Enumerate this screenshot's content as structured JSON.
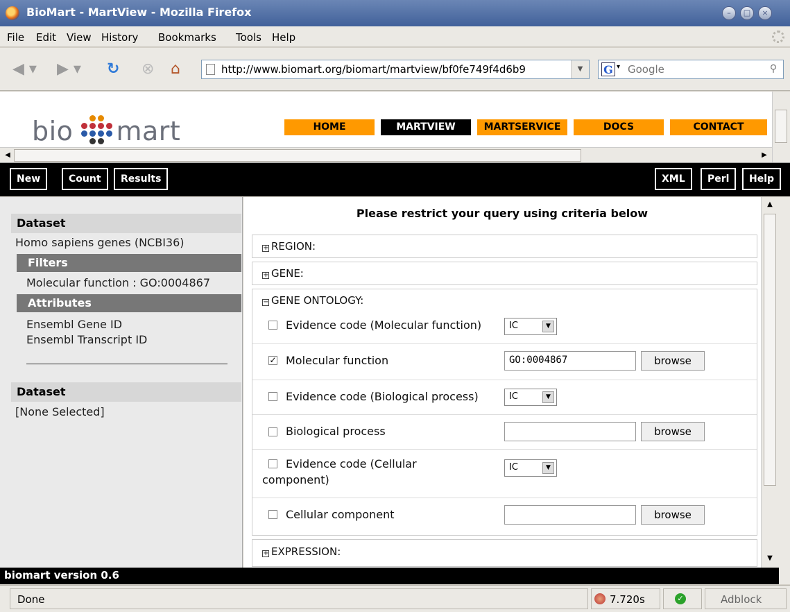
{
  "window": {
    "title": "BioMart - MartView - Mozilla Firefox"
  },
  "menu": [
    "File",
    "Edit",
    "View",
    "History",
    "Bookmarks",
    "Tools",
    "Help"
  ],
  "nav": {
    "url": "http://www.biomart.org/biomart/martview/bf0fe749f4d6b9",
    "search_placeholder": "Google"
  },
  "header": {
    "logo_left": "bio",
    "logo_right": "mart",
    "links": [
      "HOME",
      "MARTVIEW",
      "MARTSERVICE",
      "DOCS",
      "CONTACT"
    ],
    "active_link": "MARTVIEW",
    "link_color": "#ff9900"
  },
  "toolbar": {
    "left_buttons": [
      "New",
      "Count",
      "Results"
    ],
    "right_buttons": [
      "XML",
      "Perl",
      "Help"
    ]
  },
  "summary": {
    "dataset_heading": "Dataset",
    "dataset_name": "Homo sapiens genes (NCBI36)",
    "filters_heading": "Filters",
    "filter_value": "Molecular function : GO:0004867",
    "attributes_heading": "Attributes",
    "attributes": [
      "Ensembl Gene ID",
      "Ensembl Transcript ID"
    ],
    "dataset2_heading": "Dataset",
    "dataset2_value": "[None Selected]"
  },
  "main": {
    "title": "Please restrict your query using criteria below",
    "sections": {
      "region": "REGION:",
      "gene": "GENE:",
      "gene_ontology": "GENE ONTOLOGY:",
      "expression": "EXPRESSION:"
    },
    "filters": {
      "ev_mol_label": "Evidence code (Molecular function)",
      "ev_mol_value": "IC",
      "mol_label": "Molecular function",
      "mol_value": "GO:0004867",
      "ev_bio_label": "Evidence code (Biological process)",
      "ev_bio_value": "IC",
      "bio_label": "Biological process",
      "bio_value": "",
      "ev_cell_label_1": "Evidence code (Cellular",
      "ev_cell_label_2": "component)",
      "ev_cell_value": "IC",
      "cell_label": "Cellular component",
      "cell_value": "",
      "browse": "browse"
    }
  },
  "footer": {
    "version": "biomart version 0.6"
  },
  "status": {
    "text": "Done",
    "timer": "7.720s",
    "adblock": "Adblock"
  }
}
